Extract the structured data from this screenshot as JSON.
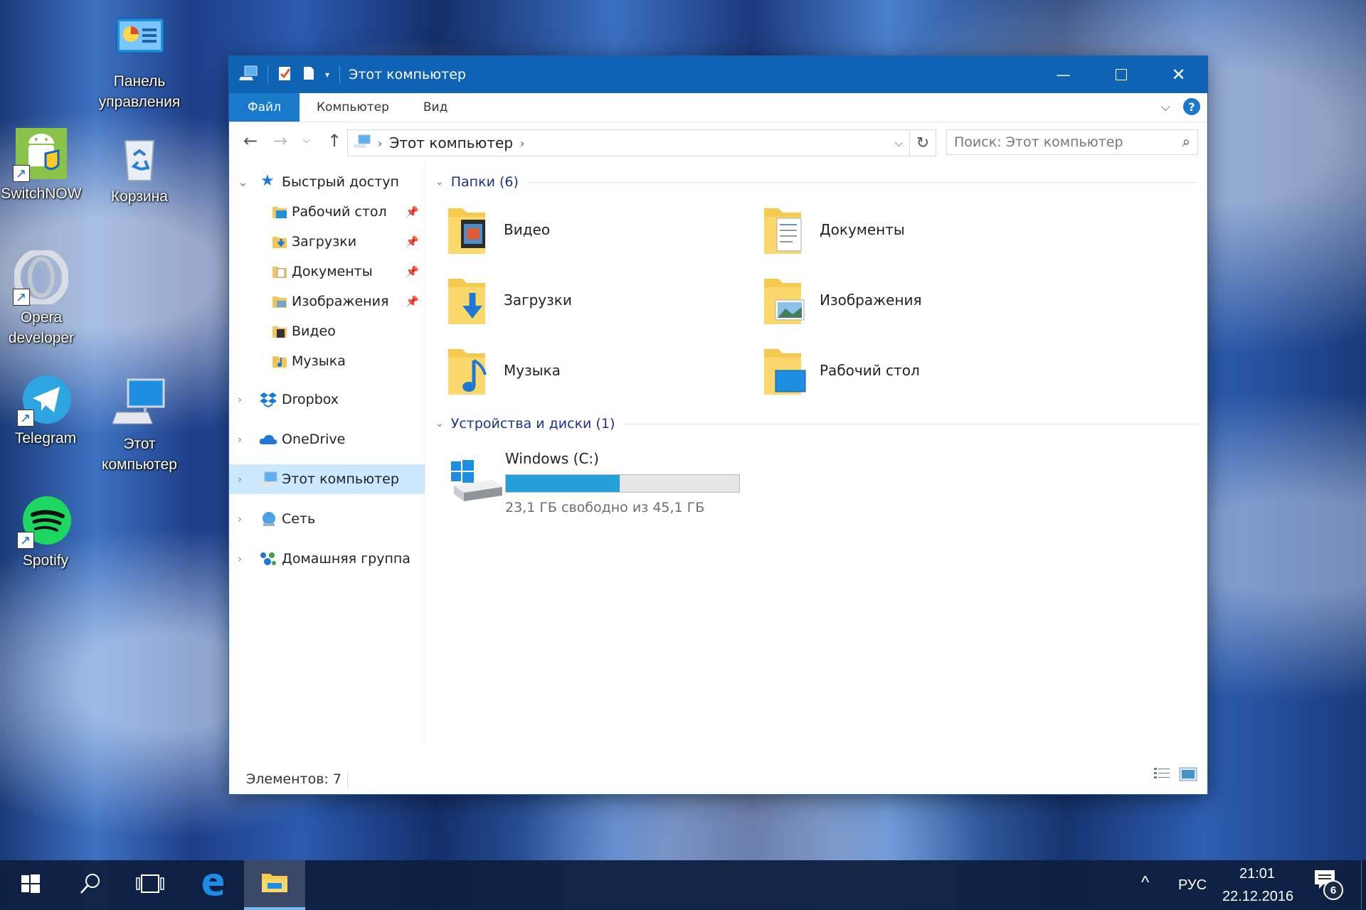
{
  "desktop": {
    "icons": [
      {
        "label_line1": "Панель",
        "label_line2": "управления"
      },
      {
        "label_line1": "SwitchNOW",
        "label_line2": ""
      },
      {
        "label_line1": "Корзина",
        "label_line2": ""
      },
      {
        "label_line1": "Opera",
        "label_line2": "developer"
      },
      {
        "label_line1": "Telegram",
        "label_line2": ""
      },
      {
        "label_line1": "Этот",
        "label_line2": "компьютер"
      },
      {
        "label_line1": "Spotify",
        "label_line2": ""
      }
    ]
  },
  "window": {
    "title": "Этот компьютер",
    "ribbon": {
      "tabs": [
        "Файл",
        "Компьютер",
        "Вид"
      ],
      "help": "?"
    },
    "address": {
      "location": "Этот компьютер"
    },
    "search": {
      "placeholder": "Поиск: Этот компьютер"
    },
    "nav": {
      "quick_access": "Быстрый доступ",
      "quick_items": [
        "Рабочий стол",
        "Загрузки",
        "Документы",
        "Изображения",
        "Видео",
        "Музыка"
      ],
      "dropbox": "Dropbox",
      "onedrive": "OneDrive",
      "this_pc": "Этот компьютер",
      "network": "Сеть",
      "homegroup": "Домашняя группа"
    },
    "folders_header": "Папки (6)",
    "folders": [
      "Видео",
      "Документы",
      "Загрузки",
      "Изображения",
      "Музыка",
      "Рабочий стол"
    ],
    "devices_header": "Устройства и диски (1)",
    "drive": {
      "name": "Windows (C:)",
      "free_text": "23,1 ГБ свободно из 45,1 ГБ",
      "used_fraction": 0.488
    },
    "status": {
      "items_count": "Элементов: 7"
    }
  },
  "taskbar": {
    "language": "РУС",
    "time": "21:01",
    "date": "22.12.2016",
    "notifications": "6"
  },
  "colors": {
    "accent": "#0e63b5",
    "selection": "#cce8ff",
    "drive_bar": "#26a0da"
  }
}
